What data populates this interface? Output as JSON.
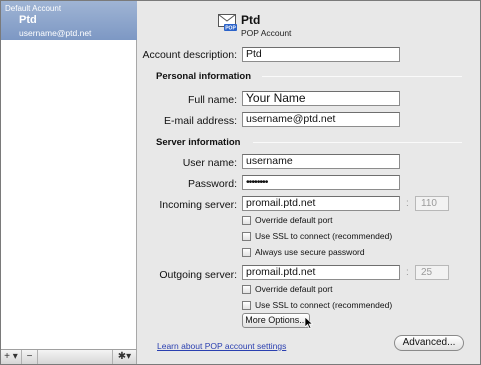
{
  "sidebar": {
    "group_label": "Default Account",
    "account_name": "Ptd",
    "account_email": "username@ptd.net",
    "footer": {
      "add": "+ ▾",
      "remove": "−",
      "action": "✱▾"
    }
  },
  "header": {
    "account_name": "Ptd",
    "account_type": "POP Account",
    "icon": "envelope-pop-icon"
  },
  "form": {
    "account_description": {
      "label": "Account description:",
      "value": "Ptd"
    },
    "personal_section": "Personal information",
    "full_name": {
      "label": "Full name:",
      "value": "Your Name"
    },
    "email": {
      "label": "E-mail address:",
      "value": "username@ptd.net"
    },
    "server_section": "Server information",
    "user_name": {
      "label": "User name:",
      "value": "username"
    },
    "password": {
      "label": "Password:",
      "value": "••••••••"
    },
    "incoming": {
      "label": "Incoming server:",
      "value": "promail.ptd.net",
      "port": "110",
      "options": [
        "Override default port",
        "Use SSL to connect (recommended)",
        "Always use secure password"
      ]
    },
    "outgoing": {
      "label": "Outgoing server:",
      "value": "promail.ptd.net",
      "port": "25",
      "options": [
        "Override default port",
        "Use SSL to connect (recommended)"
      ],
      "more_options": "More Options..."
    },
    "learn_link": "Learn about POP account settings",
    "advanced_button": "Advanced..."
  }
}
